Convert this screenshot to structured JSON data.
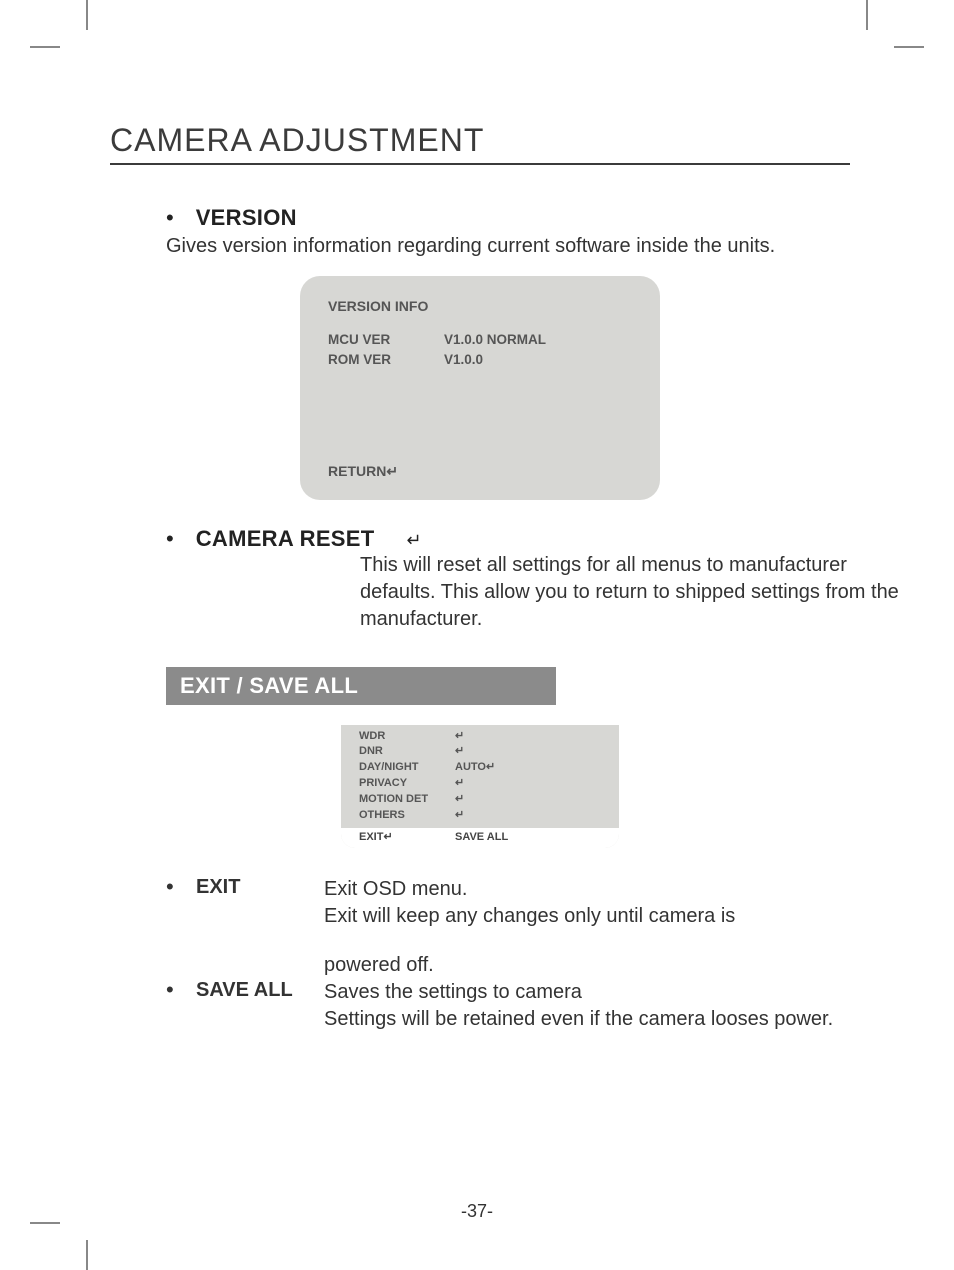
{
  "page_title": "CAMERA ADJUSTMENT",
  "version": {
    "label": "VERSION",
    "subtitle": "Gives version information regarding current software inside the units.",
    "osd": {
      "title": "VERSION INFO",
      "mcu_label": "MCU VER",
      "mcu_value": "V1.0.0 NORMAL",
      "rom_label": "ROM VER",
      "rom_value": "V1.0.0",
      "return_label": "RETURN↵"
    }
  },
  "camera_reset": {
    "label": "CAMERA RESET",
    "glyph": "↵",
    "description": "This will reset all settings for all menus  to manufacturer defaults. This allow you to return to shipped settings from the manufacturer."
  },
  "exit_save": {
    "bar_label": "EXIT / SAVE ALL",
    "menu": {
      "items": [
        {
          "k": "WDR",
          "v": "↵"
        },
        {
          "k": "DNR",
          "v": "↵"
        },
        {
          "k": "DAY/NIGHT",
          "v": "AUTO↵"
        },
        {
          "k": "PRIVACY",
          "v": "↵"
        },
        {
          "k": "MOTION DET",
          "v": "↵"
        },
        {
          "k": "OTHERS",
          "v": "↵"
        }
      ],
      "footer_left": "EXIT↵",
      "footer_right": "SAVE ALL"
    },
    "exit": {
      "label": "EXIT",
      "line1": "Exit OSD menu.",
      "line2": "Exit will keep any changes only until camera is",
      "line3": "powered off."
    },
    "save_all": {
      "label": "SAVE ALL",
      "line1": "Saves the settings to camera",
      "line2": "Settings will be retained even if the camera looses power."
    }
  },
  "page_number": "-37-"
}
